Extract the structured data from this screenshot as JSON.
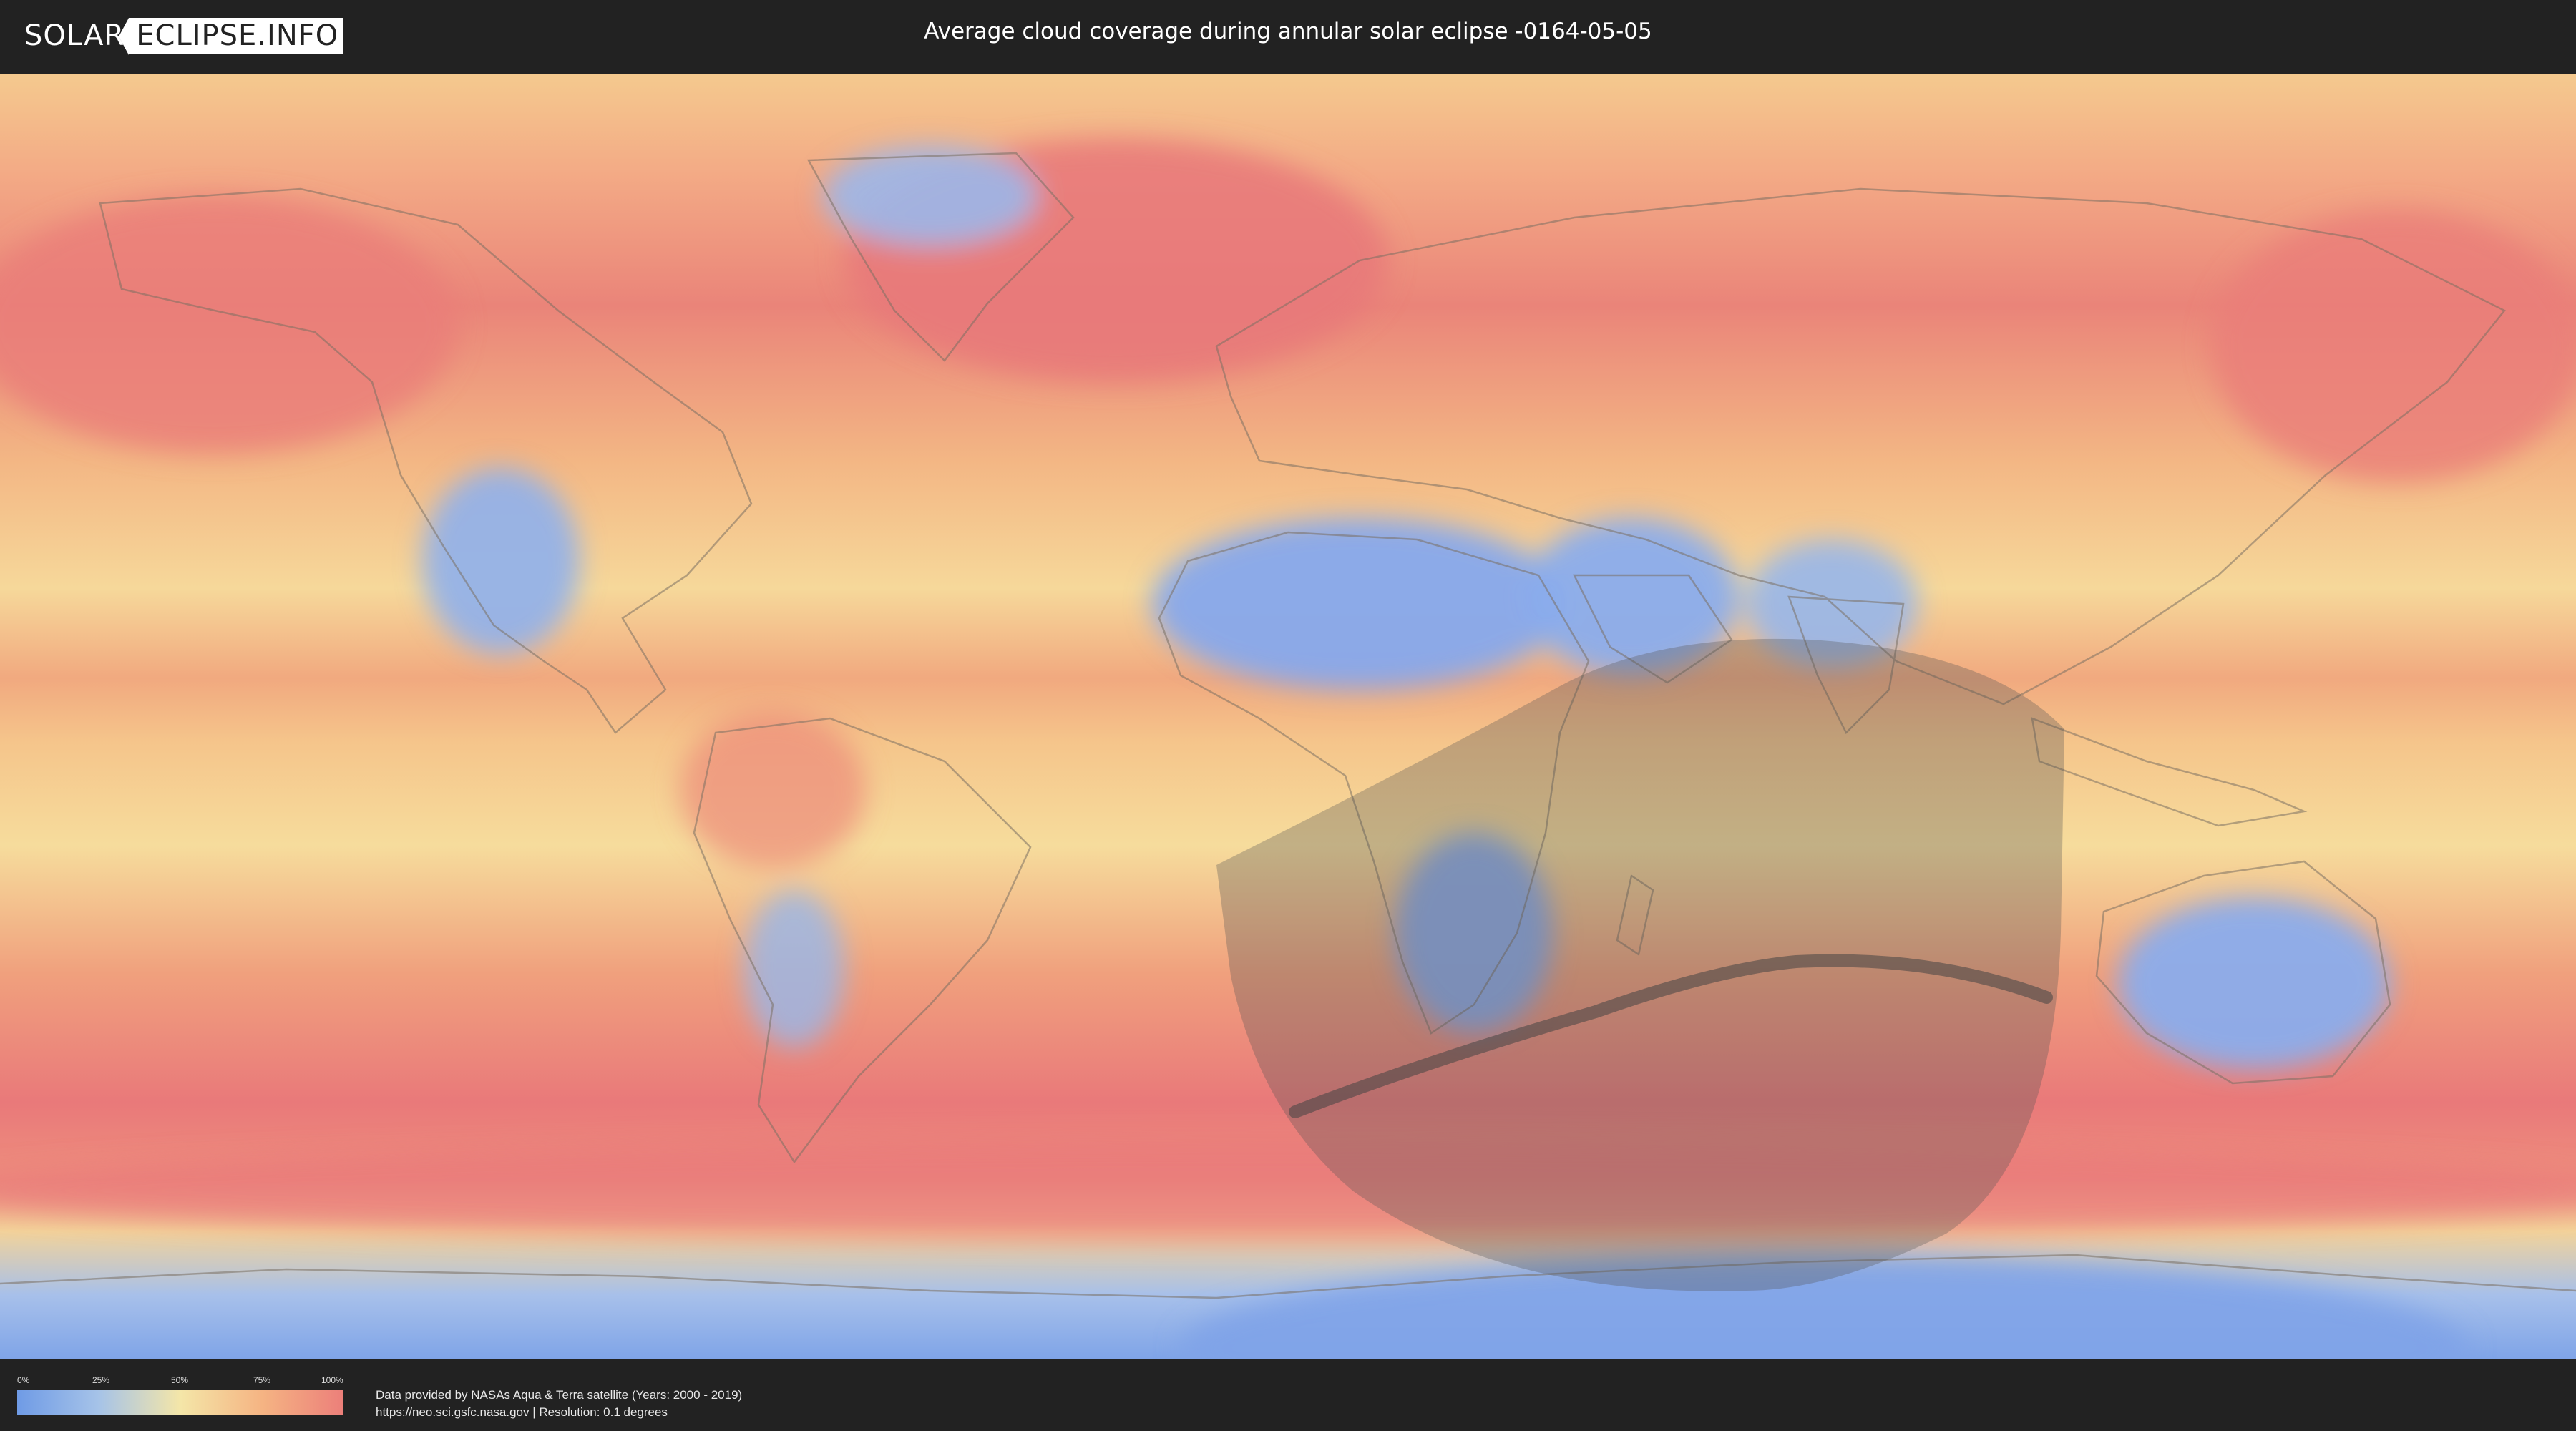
{
  "header": {
    "logo_part1": "SOLAR",
    "logo_part2": "ECLIPSE.INFO",
    "title": "Average cloud coverage during annular solar eclipse -0164-05-05"
  },
  "legend": {
    "ticks": [
      "0%",
      "25%",
      "50%",
      "75%",
      "100%"
    ],
    "colors": [
      "#6f9be6",
      "#a6c3e8",
      "#f4e6a8",
      "#f5b483",
      "#ec7f7a"
    ]
  },
  "footer": {
    "source_line1": "Data provided by NASAs Aqua & Terra satellite (Years: 2000 - 2019)",
    "source_line2": "https://neo.sci.gsfc.nasa.gov | Resolution: 0.1 degrees"
  },
  "map": {
    "colors": {
      "ocean_high_cloud": "#ec7f7a",
      "mid_cloud": "#f5b483",
      "low_cloud": "#f4e6a8",
      "clear_sky": "#8fb0ec",
      "eclipse_shadow": "#555555",
      "central_path": "#444444"
    }
  }
}
